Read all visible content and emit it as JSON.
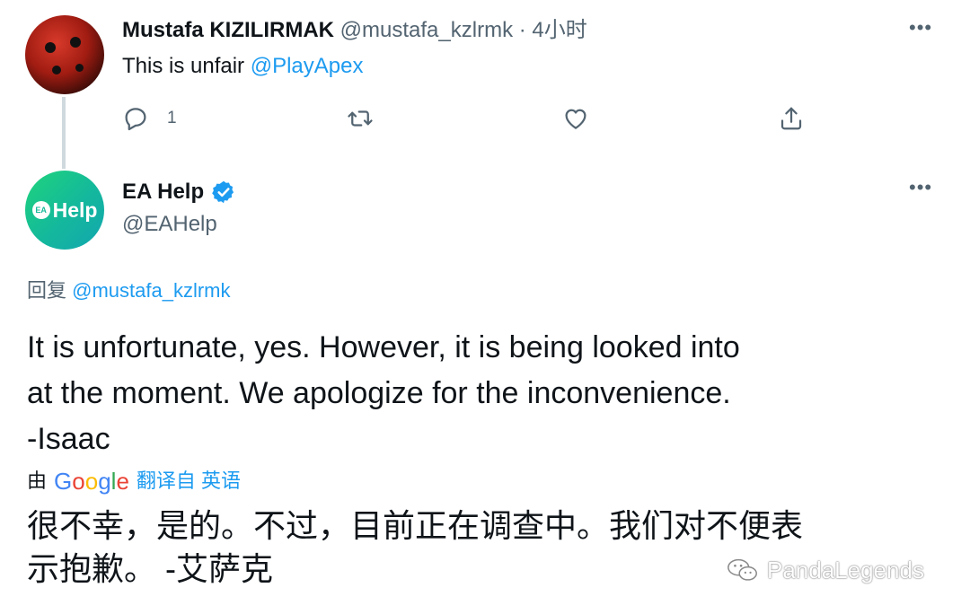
{
  "tweet1": {
    "author_name": "Mustafa KIZILIRMAK",
    "author_handle": "@mustafa_kzlrmk",
    "separator": "·",
    "time": "4小时",
    "text_prefix": "This is unfair ",
    "mention": "@PlayApex",
    "more": "•••",
    "actions": {
      "reply_count": "1",
      "retweet_count": "",
      "like_count": ""
    }
  },
  "tweet2": {
    "author_name": "EA Help",
    "author_handle": "@EAHelp",
    "avatar_ea": "EA",
    "avatar_text": "Help",
    "more": "•••",
    "reply_prefix": "回复 ",
    "reply_to": "@mustafa_kzlrmk",
    "text_lines": [
      "It is unfortunate, yes. However, it is being looked into",
      "at the moment. We apologize for the inconvenience.",
      "-Isaac"
    ],
    "translated_by": "由",
    "google": [
      "G",
      "o",
      "o",
      "g",
      "l",
      "e"
    ],
    "translated_from": "翻译自 英语",
    "translation_lines": [
      "很不幸，是的。不过，目前正在调查中。我们对不便表",
      "示抱歉。 -艾萨克"
    ]
  },
  "watermark": "PandaLegends",
  "colors": {
    "link": "#1d9bf0",
    "muted": "#536471",
    "text": "#0f1419",
    "verified": "#1d9bf0",
    "google_blue": "#4285f4",
    "google_red": "#ea4335",
    "google_yellow": "#fbbc05",
    "google_green": "#34a853"
  }
}
